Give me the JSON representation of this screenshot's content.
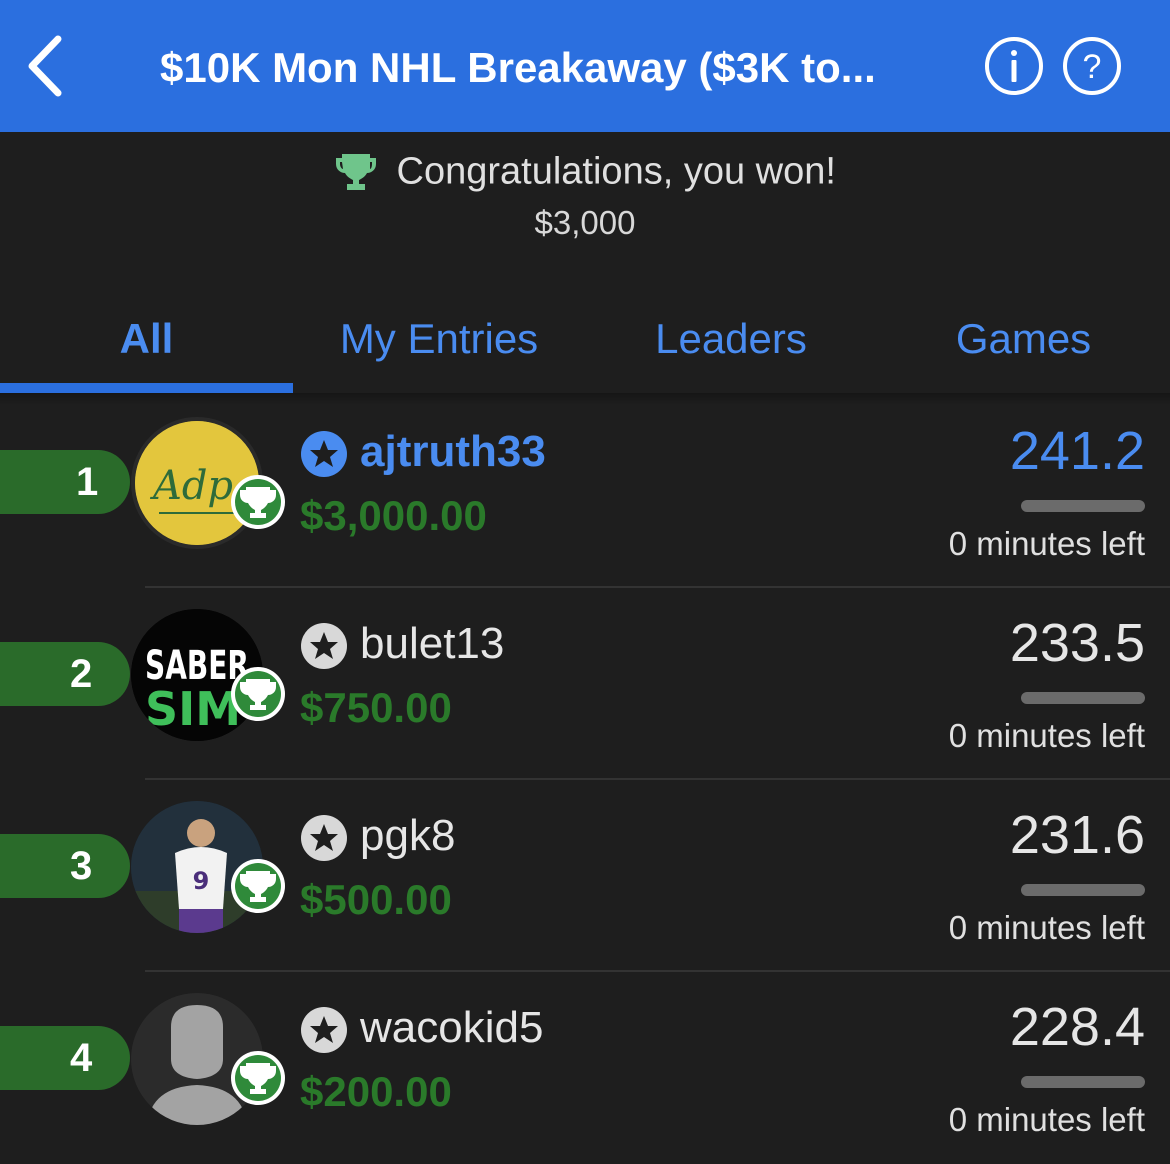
{
  "header": {
    "title": "$10K Mon NHL Breakaway ($3K to...",
    "back_icon": "chevron-left-icon",
    "info_icon": "info-icon",
    "help_icon": "help-icon",
    "bg_color": "#2b6fdf"
  },
  "banner": {
    "message": "Congratulations, you won!",
    "prize": "$3,000",
    "trophy_icon": "trophy-icon",
    "trophy_color": "#6fc58b"
  },
  "tabs": [
    {
      "label": "All",
      "active": true
    },
    {
      "label": "My Entries",
      "active": false
    },
    {
      "label": "Leaders",
      "active": false
    },
    {
      "label": "Games",
      "active": false
    }
  ],
  "entries": [
    {
      "rank": "1",
      "username": "ajtruth33",
      "winnings": "$3,000.00",
      "score": "241.2",
      "time_left": "0 minutes left",
      "highlight": true,
      "avatar_text": "Adp",
      "progress": 1.0
    },
    {
      "rank": "2",
      "username": "bulet13",
      "winnings": "$750.00",
      "score": "233.5",
      "time_left": "0 minutes left",
      "highlight": false,
      "avatar_text": "SABER SIM",
      "progress": 1.0
    },
    {
      "rank": "3",
      "username": "pgk8",
      "winnings": "$500.00",
      "score": "231.6",
      "time_left": "0 minutes left",
      "highlight": false,
      "avatar_text": "9",
      "progress": 1.0
    },
    {
      "rank": "4",
      "username": "wacokid5",
      "winnings": "$200.00",
      "score": "228.4",
      "time_left": "0 minutes left",
      "highlight": false,
      "avatar_text": "",
      "progress": 1.0
    }
  ],
  "colors": {
    "accent": "#2b6fdf",
    "tab_text": "#4a8cf0",
    "highlight_user": "#4a8cf0",
    "winnings": "#2a7a2a",
    "rank_tab": "#2a6b2a",
    "background": "#1e1e1e"
  }
}
